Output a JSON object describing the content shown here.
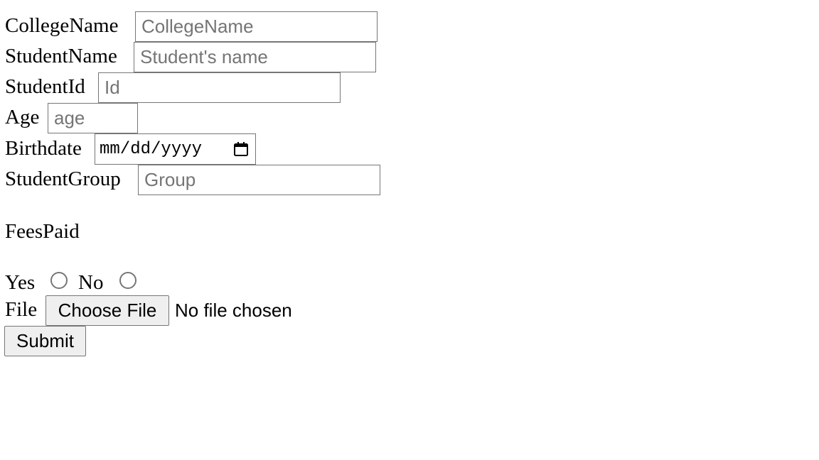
{
  "form": {
    "college_name": {
      "label": "CollegeName",
      "placeholder": "CollegeName",
      "value": ""
    },
    "student_name": {
      "label": "StudentName",
      "placeholder": "Student's name",
      "value": ""
    },
    "student_id": {
      "label": "StudentId",
      "placeholder": "Id",
      "value": ""
    },
    "age": {
      "label": "Age",
      "placeholder": "age",
      "value": ""
    },
    "birthdate": {
      "label": "Birthdate",
      "placeholder": "mm/dd/yyyy",
      "icon": "calendar-icon"
    },
    "student_group": {
      "label": "StudentGroup",
      "placeholder": "Group",
      "value": ""
    },
    "fees_paid": {
      "label": "FeesPaid",
      "options": [
        {
          "label": "Yes",
          "checked": false
        },
        {
          "label": "No",
          "checked": false
        }
      ]
    },
    "file": {
      "label": "File",
      "button_label": "Choose File",
      "status": "No file chosen"
    },
    "submit_label": "Submit"
  }
}
